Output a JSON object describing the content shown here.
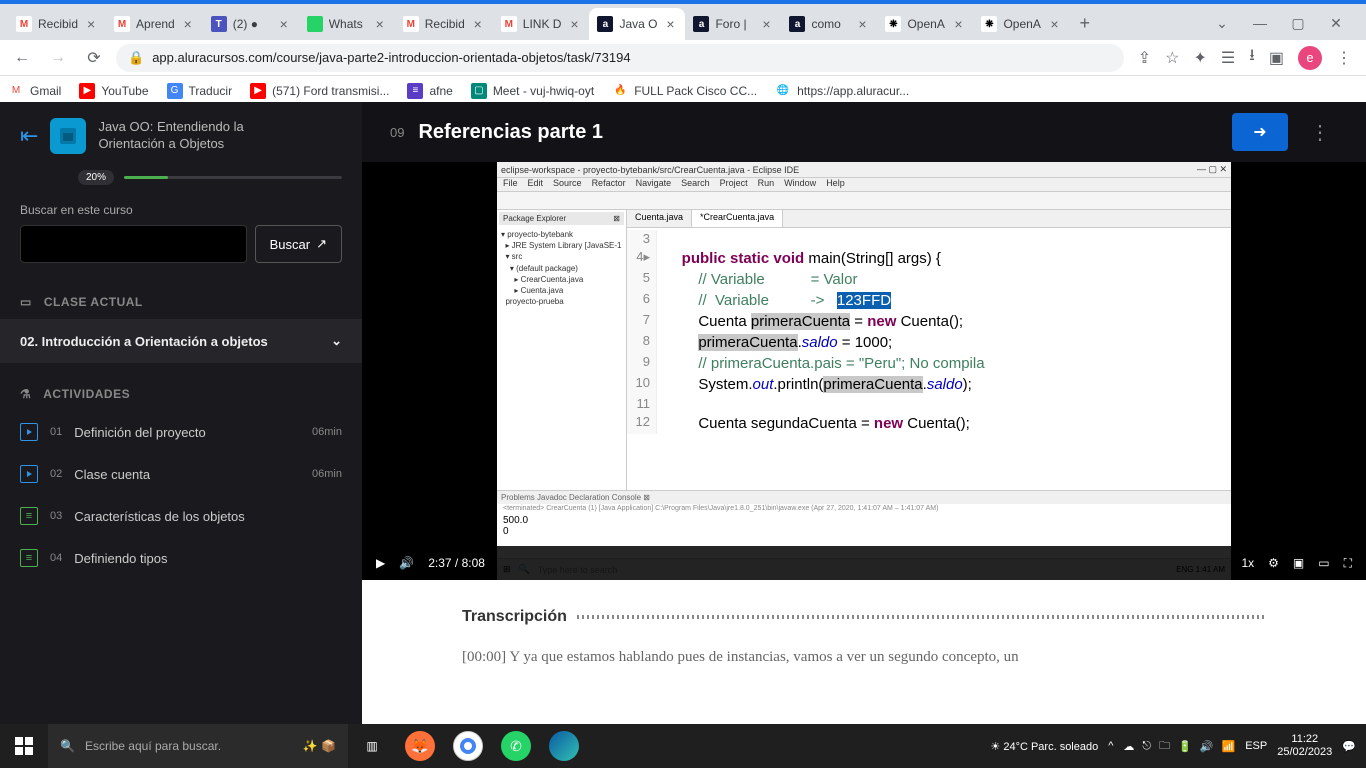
{
  "browser": {
    "tabs": [
      {
        "fav": "M",
        "favbg": "#fff",
        "favcolor": "#ea4335",
        "title": "Recibid"
      },
      {
        "fav": "M",
        "favbg": "#fff",
        "favcolor": "#ea4335",
        "title": "Aprend"
      },
      {
        "fav": "T",
        "favbg": "#4b53bc",
        "favcolor": "#fff",
        "title": "(2) ●"
      },
      {
        "fav": "",
        "favbg": "#25d366",
        "favcolor": "#fff",
        "title": "Whats"
      },
      {
        "fav": "M",
        "favbg": "#fff",
        "favcolor": "#ea4335",
        "title": "Recibid"
      },
      {
        "fav": "M",
        "favbg": "#fff",
        "favcolor": "#ea4335",
        "title": "LINK D"
      },
      {
        "fav": "a",
        "favbg": "#10162f",
        "favcolor": "#fff",
        "title": "Java O",
        "active": true
      },
      {
        "fav": "a",
        "favbg": "#10162f",
        "favcolor": "#fff",
        "title": "Foro |"
      },
      {
        "fav": "a",
        "favbg": "#10162f",
        "favcolor": "#fff",
        "title": "como"
      },
      {
        "fav": "❋",
        "favbg": "#fff",
        "favcolor": "#000",
        "title": "OpenA"
      },
      {
        "fav": "❋",
        "favbg": "#fff",
        "favcolor": "#000",
        "title": "OpenA"
      }
    ],
    "url": "app.aluracursos.com/course/java-parte2-introduccion-orientada-objetos/task/73194",
    "bookmarks": [
      {
        "ico": "M",
        "bg": "#fff",
        "color": "#ea4335",
        "label": "Gmail"
      },
      {
        "ico": "▶",
        "bg": "#ff0000",
        "color": "#fff",
        "label": "YouTube"
      },
      {
        "ico": "G",
        "bg": "#4285f4",
        "color": "#fff",
        "label": "Traducir"
      },
      {
        "ico": "▶",
        "bg": "#ff0000",
        "color": "#fff",
        "label": "(571) Ford transmisi..."
      },
      {
        "ico": "≡",
        "bg": "#5b3cc4",
        "color": "#fff",
        "label": "afne"
      },
      {
        "ico": "▢",
        "bg": "#00897b",
        "color": "#fff",
        "label": "Meet - vuj-hwiq-oyt"
      },
      {
        "ico": "🔥",
        "bg": "#fff",
        "color": "#ff6d00",
        "label": "FULL Pack Cisco CC..."
      },
      {
        "ico": "🌐",
        "bg": "#fff",
        "color": "#555",
        "label": "https://app.aluracur..."
      }
    ]
  },
  "course": {
    "title_line1": "Java OO: Entendiendo la",
    "title_line2": "Orientación a Objetos",
    "progress_pct": "20%",
    "search_label": "Buscar en este curso",
    "search_btn": "Buscar",
    "section_current": "CLASE ACTUAL",
    "current_class": "02. Introducción a Orientación a objetos",
    "section_activities": "ACTIVIDADES",
    "activities": [
      {
        "num": "01",
        "title": "Definición del proyecto",
        "dur": "06min",
        "type": "play"
      },
      {
        "num": "02",
        "title": "Clase cuenta",
        "dur": "06min",
        "type": "play"
      },
      {
        "num": "03",
        "title": "Características de los objetos",
        "dur": "",
        "type": "list"
      },
      {
        "num": "04",
        "title": "Definiendo tipos",
        "dur": "",
        "type": "list"
      }
    ]
  },
  "lesson": {
    "num": "09",
    "title": "Referencias parte 1"
  },
  "video": {
    "eclipse_title": "eclipse-workspace - proyecto-bytebank/src/CrearCuenta.java - Eclipse IDE",
    "menus": [
      "File",
      "Edit",
      "Source",
      "Refactor",
      "Navigate",
      "Search",
      "Project",
      "Run",
      "Window",
      "Help"
    ],
    "pkg_header": "Package Explorer",
    "tree": [
      "▾ proyecto-bytebank",
      "  ▸ JRE System Library [JavaSE-1.8",
      "  ▾ src",
      "    ▾ (default package)",
      "      ▸ CrearCuenta.java",
      "      ▸ Cuenta.java",
      "  proyecto-prueba"
    ],
    "ed_tabs": [
      "Cuenta.java",
      "*CrearCuenta.java"
    ],
    "code_lines": [
      {
        "n": "3",
        "html": ""
      },
      {
        "n": "4▸",
        "html": "    <span class='kw'>public static void</span> main(String[] args) {"
      },
      {
        "n": "5",
        "html": "        <span class='cm'>// Variable           = Valor</span>"
      },
      {
        "n": "6",
        "html": "        <span class='cm'>//  Variable          -&gt;   </span><span class='sel'>123FFD</span>"
      },
      {
        "n": "7",
        "html": "        Cuenta <span class='hl'>primeraCuenta</span> = <span class='kw'>new</span> Cuenta();"
      },
      {
        "n": "8",
        "html": "        <span class='hl'>primeraCuenta</span>.<span class='fld'>saldo</span> = 1000;"
      },
      {
        "n": "9",
        "html": "        <span class='cm'>// primeraCuenta.pais = \"Peru\"; No compila</span>"
      },
      {
        "n": "10",
        "html": "        System.<span class='fld'>out</span>.println(<span class='hl'>primeraCuenta</span>.<span class='fld'>saldo</span>);"
      },
      {
        "n": "11",
        "html": ""
      },
      {
        "n": "12",
        "html": "        Cuenta segundaCuenta = <span class='kw'>new</span> Cuenta();"
      }
    ],
    "console_tabs": "Problems   Javadoc   Declaration   Console ⊠",
    "console_term": "<terminated> CrearCuenta (1) [Java Application] C:\\Program Files\\Java\\jre1.8.0_251\\bin\\javaw.exe  (Apr 27, 2020, 1:41:07 AM – 1:41:07 AM)",
    "console_out": [
      "500.0",
      "0"
    ],
    "taskbar_search": "Type here to search",
    "time": "2:37",
    "dur": "8:08",
    "speed": "1x"
  },
  "transcript": {
    "heading": "Transcripción",
    "body": "[00:00] Y ya que estamos hablando pues de instancias, vamos a ver un segundo concepto, un"
  },
  "taskbar": {
    "search": "Escribe aquí para buscar.",
    "weather": "24°C  Parc. soleado",
    "lang": "ESP",
    "time": "11:22",
    "date": "25/02/2023"
  }
}
